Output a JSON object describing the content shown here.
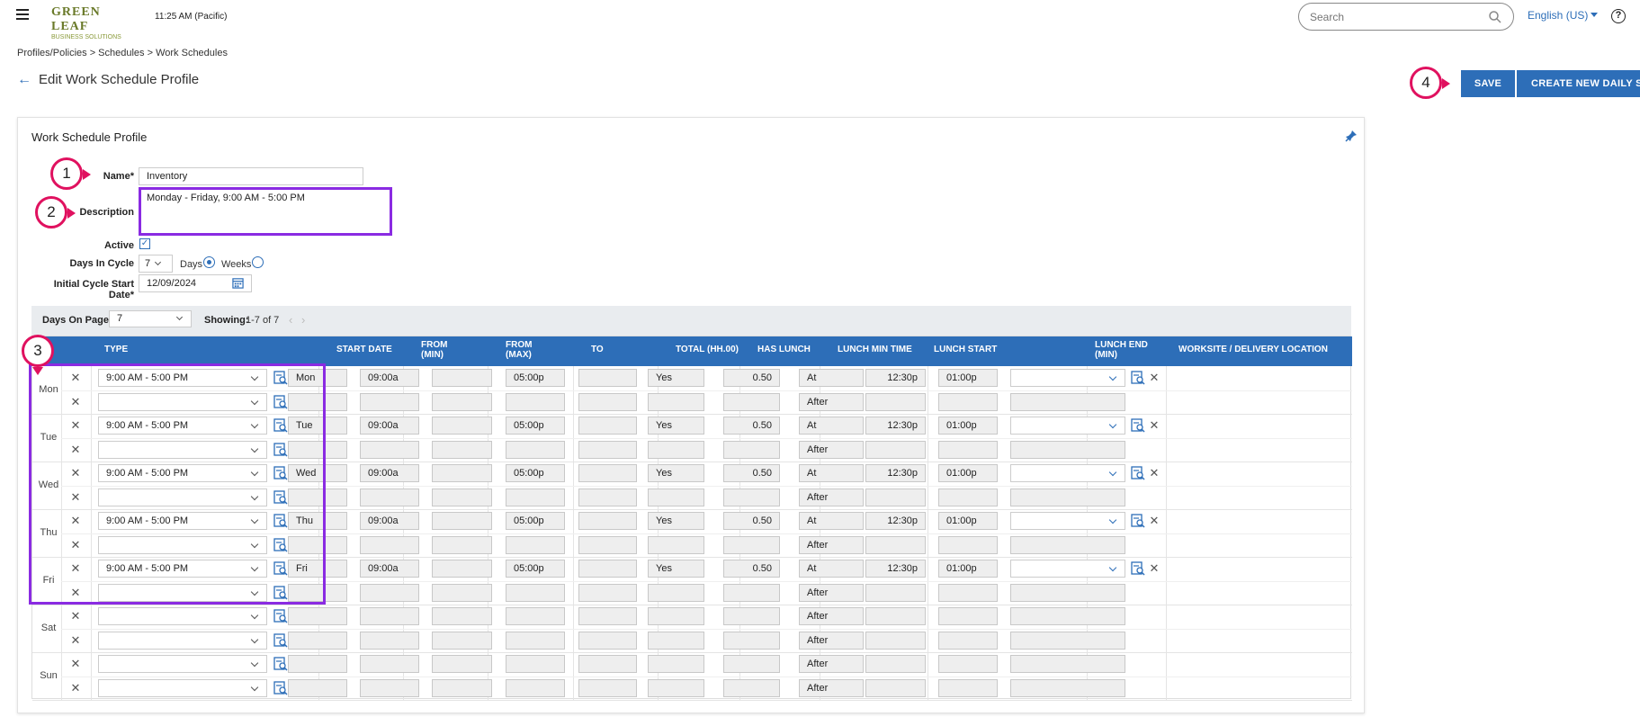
{
  "header": {
    "logo_line1": "GREEN LEAF",
    "logo_line2": "BUSINESS SOLUTIONS",
    "time": "11:25 AM (Pacific)",
    "search_placeholder": "Search",
    "language": "English (US)",
    "help": "?"
  },
  "breadcrumb": "Profiles/Policies > Schedules > Work Schedules",
  "page_title": "Edit Work Schedule Profile",
  "buttons": {
    "save": "SAVE",
    "create": "CREATE NEW DAILY SCHEDULE"
  },
  "markers": [
    "1",
    "2",
    "3",
    "4"
  ],
  "card_title": "Work Schedule Profile",
  "form": {
    "name_label": "Name*",
    "name_value": "Inventory",
    "description_label": "Description",
    "description_value": "Monday - Friday, 9:00 AM - 5:00 PM",
    "active_label": "Active",
    "days_in_cycle_label": "Days In Cycle",
    "days_in_cycle_value": "7",
    "days_option": "Days",
    "weeks_option": "Weeks",
    "start_date_label": "Initial Cycle Start Date*",
    "start_date_value": "12/09/2024"
  },
  "toolbar": {
    "days_on_page_label": "Days On Page",
    "days_on_page_value": "7",
    "showing_label": "Showing:",
    "showing_value": "1-7 of 7"
  },
  "columns": {
    "type": "TYPE",
    "start_date": "START DATE",
    "from_min_1": "FROM",
    "from_min_2": "(MIN)",
    "from_max_1": "FROM",
    "from_max_2": "(MAX)",
    "to": "TO",
    "total": "TOTAL (HH.00)",
    "has_lunch": "HAS LUNCH",
    "lunch_min_time": "LUNCH MIN TIME",
    "lunch_start": "LUNCH START",
    "lunch_end_1": "LUNCH END",
    "lunch_end_2": "(MIN)",
    "worksite": "WORKSITE / DELIVERY LOCATION"
  },
  "days": [
    {
      "day": "Mon",
      "type": "9:00 AM - 5:00 PM",
      "start": "Mon",
      "from_min": "09:00a",
      "to": "05:00p",
      "has_lunch": "Yes",
      "lunch_min": "0.50",
      "lunch_at": "At",
      "lunch_time": "12:30p",
      "lunch_end": "01:00p",
      "after": "After"
    },
    {
      "day": "Tue",
      "type": "9:00 AM - 5:00 PM",
      "start": "Tue",
      "from_min": "09:00a",
      "to": "05:00p",
      "has_lunch": "Yes",
      "lunch_min": "0.50",
      "lunch_at": "At",
      "lunch_time": "12:30p",
      "lunch_end": "01:00p",
      "after": "After"
    },
    {
      "day": "Wed",
      "type": "9:00 AM - 5:00 PM",
      "start": "Wed",
      "from_min": "09:00a",
      "to": "05:00p",
      "has_lunch": "Yes",
      "lunch_min": "0.50",
      "lunch_at": "At",
      "lunch_time": "12:30p",
      "lunch_end": "01:00p",
      "after": "After"
    },
    {
      "day": "Thu",
      "type": "9:00 AM - 5:00 PM",
      "start": "Thu",
      "from_min": "09:00a",
      "to": "05:00p",
      "has_lunch": "Yes",
      "lunch_min": "0.50",
      "lunch_at": "At",
      "lunch_time": "12:30p",
      "lunch_end": "01:00p",
      "after": "After"
    },
    {
      "day": "Fri",
      "type": "9:00 AM - 5:00 PM",
      "start": "Fri",
      "from_min": "09:00a",
      "to": "05:00p",
      "has_lunch": "Yes",
      "lunch_min": "0.50",
      "lunch_at": "At",
      "lunch_time": "12:30p",
      "lunch_end": "01:00p",
      "after": "After"
    },
    {
      "day": "Sat",
      "type": "",
      "start": "",
      "from_min": "",
      "to": "",
      "has_lunch": "",
      "lunch_min": "",
      "lunch_at": "After",
      "lunch_time": "",
      "lunch_end": "",
      "after": "After"
    },
    {
      "day": "Sun",
      "type": "",
      "start": "",
      "from_min": "",
      "to": "",
      "has_lunch": "",
      "lunch_min": "",
      "lunch_at": "After",
      "lunch_time": "",
      "lunch_end": "",
      "after": "After"
    }
  ],
  "colors": {
    "accent": "#2d6eb8",
    "marker": "#e0115f",
    "highlight": "#8a2be2"
  }
}
